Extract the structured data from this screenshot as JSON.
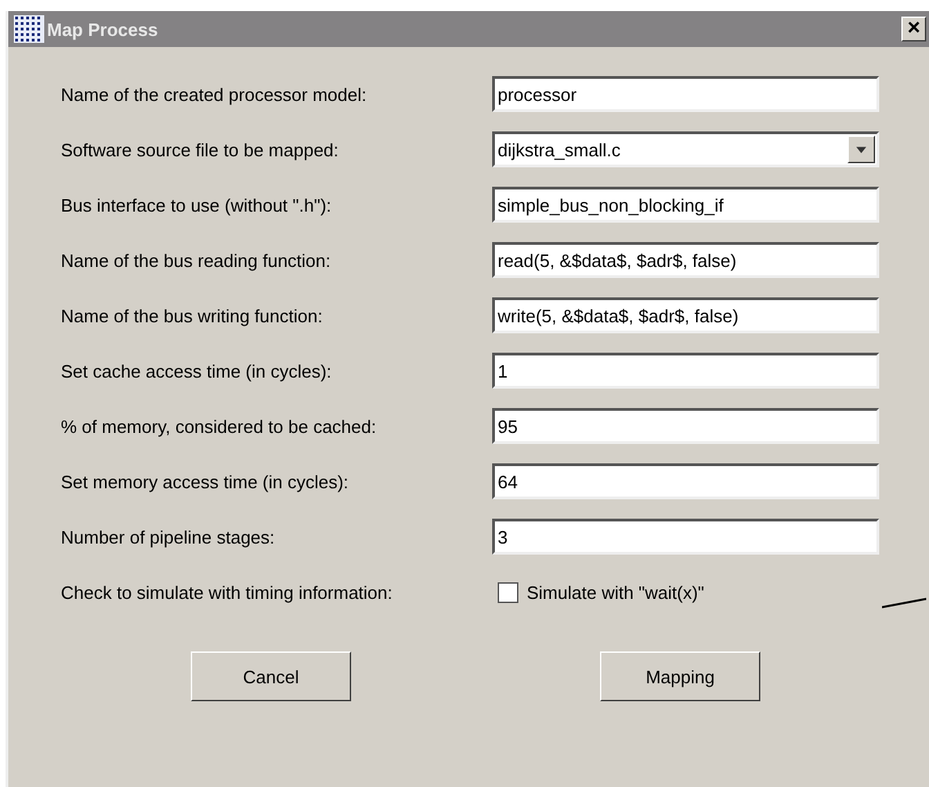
{
  "window": {
    "title": "Map Process",
    "close": "×"
  },
  "fields": [
    {
      "kind": "text",
      "label": "Name of the created processor model:",
      "value": "processor"
    },
    {
      "kind": "dropdown",
      "label": "Software source file to be mapped:",
      "value": "dijkstra_small.c"
    },
    {
      "kind": "text",
      "label": "Bus interface to use (without \".h\"):",
      "value": "simple_bus_non_blocking_if"
    },
    {
      "kind": "text",
      "label": "Name of the bus reading function:",
      "value": "read(5, &$data$, $adr$, false)"
    },
    {
      "kind": "text",
      "label": "Name of the bus writing function:",
      "value": "write(5, &$data$, $adr$, false)"
    },
    {
      "kind": "text",
      "label": "Set cache access time (in cycles):",
      "value": "1"
    },
    {
      "kind": "text",
      "label": "% of memory, considered to be cached:",
      "value": "95"
    },
    {
      "kind": "text",
      "label": "Set memory access time (in cycles):",
      "value": "64"
    },
    {
      "kind": "text",
      "label": "Number of pipeline stages:",
      "value": "3"
    },
    {
      "kind": "checkbox",
      "label": "Check to simulate with timing information:",
      "text": "Simulate with \"wait(x)\"",
      "checked": false
    }
  ],
  "buttons": [
    "Cancel",
    "Mapping"
  ]
}
